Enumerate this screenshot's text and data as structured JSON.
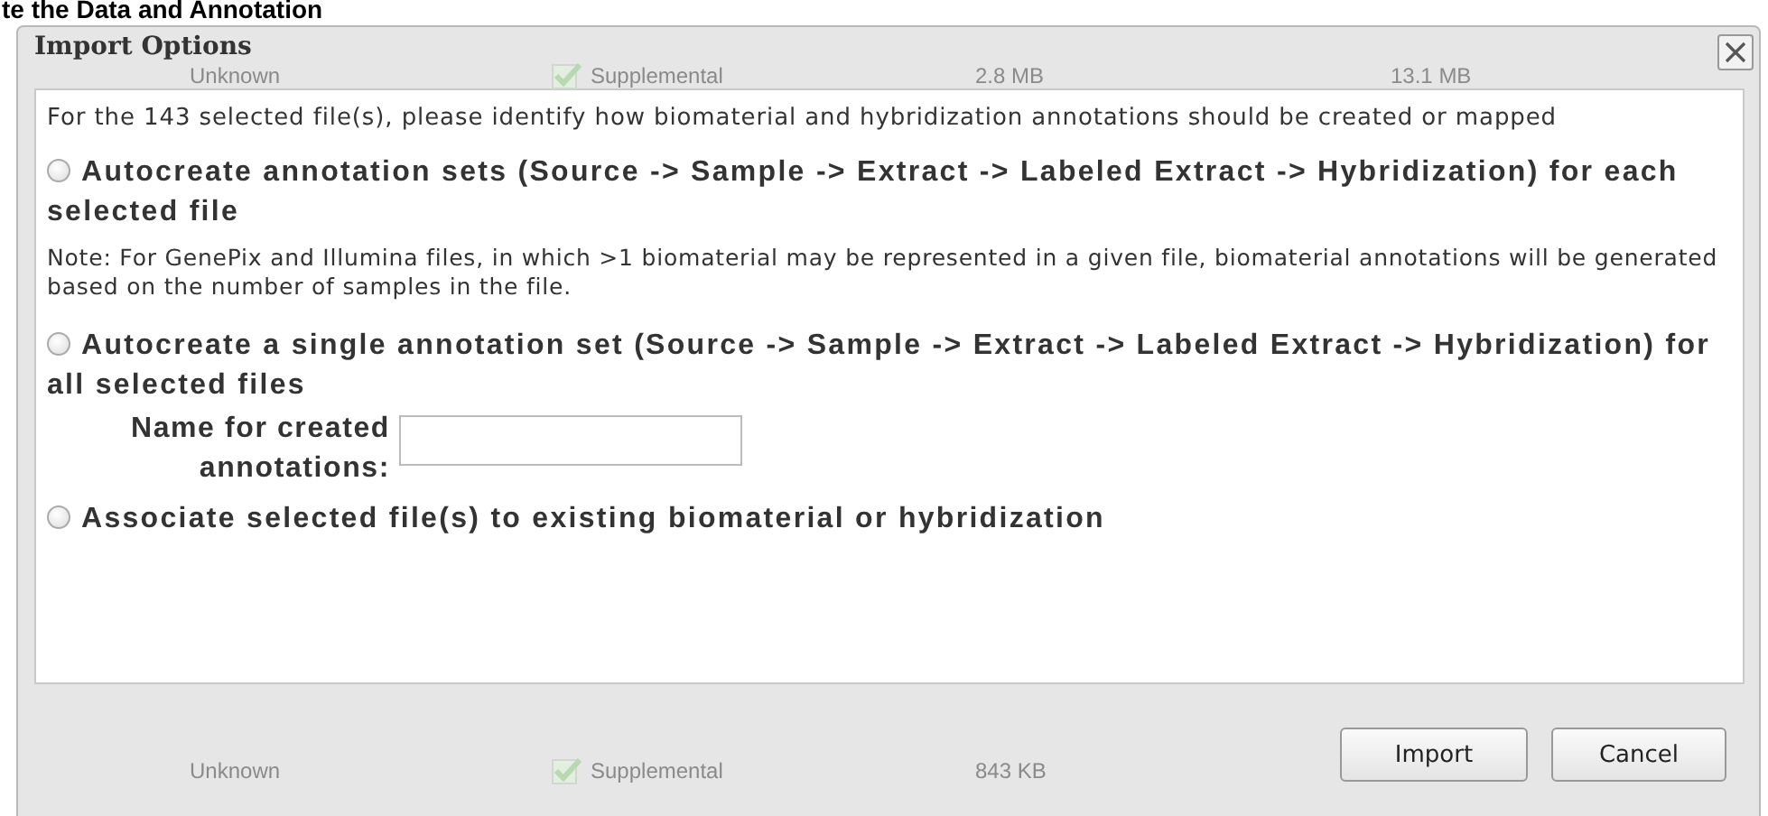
{
  "page_heading": "te the Data and Annotation",
  "background_rows": [
    {
      "cells": [
        "Unknown",
        "Supplemental",
        "2.8 MB",
        "13.1 MB"
      ]
    },
    {
      "cells": [
        "Unknown",
        "Supplemental",
        "843 KB"
      ]
    }
  ],
  "dialog": {
    "title": "Import Options",
    "intro": "For the 143 selected file(s), please identify how biomaterial and hybridization annotations should be created or mapped",
    "options": [
      {
        "label": "Autocreate annotation sets (Source -> Sample -> Extract -> Labeled Extract -> Hybridization) for each selected file",
        "selected": false,
        "note": "Note: For GenePix and Illumina files, in which >1 biomaterial may be represented in a given file, biomaterial annotations will be generated based on the number of samples in the file."
      },
      {
        "label": "Autocreate a single annotation set (Source -> Sample -> Extract -> Labeled Extract -> Hybridization) for all selected files",
        "selected": false,
        "field": {
          "label": "Name for created annotations:"
        }
      },
      {
        "label": "Associate selected file(s) to existing biomaterial or hybridization",
        "selected": false
      }
    ],
    "buttons": [
      "Import",
      "Cancel"
    ]
  }
}
